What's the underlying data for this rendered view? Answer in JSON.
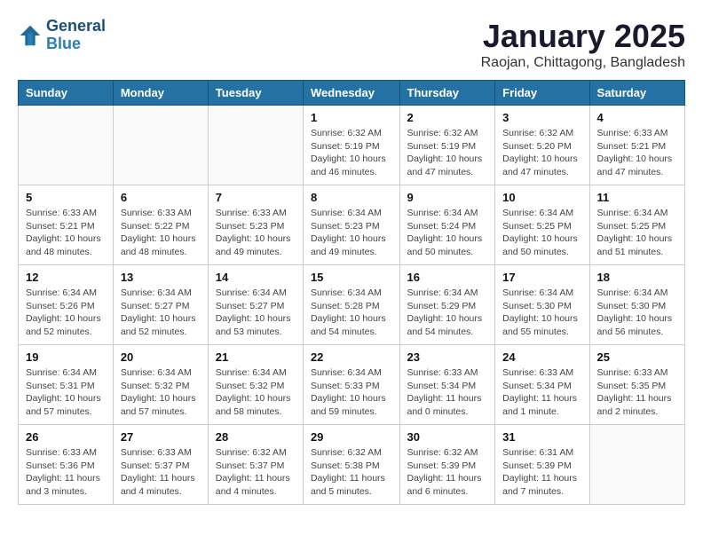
{
  "header": {
    "logo_line1": "General",
    "logo_line2": "Blue",
    "month": "January 2025",
    "location": "Raojan, Chittagong, Bangladesh"
  },
  "weekdays": [
    "Sunday",
    "Monday",
    "Tuesday",
    "Wednesday",
    "Thursday",
    "Friday",
    "Saturday"
  ],
  "weeks": [
    [
      {
        "day": "",
        "info": ""
      },
      {
        "day": "",
        "info": ""
      },
      {
        "day": "",
        "info": ""
      },
      {
        "day": "1",
        "info": "Sunrise: 6:32 AM\nSunset: 5:19 PM\nDaylight: 10 hours\nand 46 minutes."
      },
      {
        "day": "2",
        "info": "Sunrise: 6:32 AM\nSunset: 5:19 PM\nDaylight: 10 hours\nand 47 minutes."
      },
      {
        "day": "3",
        "info": "Sunrise: 6:32 AM\nSunset: 5:20 PM\nDaylight: 10 hours\nand 47 minutes."
      },
      {
        "day": "4",
        "info": "Sunrise: 6:33 AM\nSunset: 5:21 PM\nDaylight: 10 hours\nand 47 minutes."
      }
    ],
    [
      {
        "day": "5",
        "info": "Sunrise: 6:33 AM\nSunset: 5:21 PM\nDaylight: 10 hours\nand 48 minutes."
      },
      {
        "day": "6",
        "info": "Sunrise: 6:33 AM\nSunset: 5:22 PM\nDaylight: 10 hours\nand 48 minutes."
      },
      {
        "day": "7",
        "info": "Sunrise: 6:33 AM\nSunset: 5:23 PM\nDaylight: 10 hours\nand 49 minutes."
      },
      {
        "day": "8",
        "info": "Sunrise: 6:34 AM\nSunset: 5:23 PM\nDaylight: 10 hours\nand 49 minutes."
      },
      {
        "day": "9",
        "info": "Sunrise: 6:34 AM\nSunset: 5:24 PM\nDaylight: 10 hours\nand 50 minutes."
      },
      {
        "day": "10",
        "info": "Sunrise: 6:34 AM\nSunset: 5:25 PM\nDaylight: 10 hours\nand 50 minutes."
      },
      {
        "day": "11",
        "info": "Sunrise: 6:34 AM\nSunset: 5:25 PM\nDaylight: 10 hours\nand 51 minutes."
      }
    ],
    [
      {
        "day": "12",
        "info": "Sunrise: 6:34 AM\nSunset: 5:26 PM\nDaylight: 10 hours\nand 52 minutes."
      },
      {
        "day": "13",
        "info": "Sunrise: 6:34 AM\nSunset: 5:27 PM\nDaylight: 10 hours\nand 52 minutes."
      },
      {
        "day": "14",
        "info": "Sunrise: 6:34 AM\nSunset: 5:27 PM\nDaylight: 10 hours\nand 53 minutes."
      },
      {
        "day": "15",
        "info": "Sunrise: 6:34 AM\nSunset: 5:28 PM\nDaylight: 10 hours\nand 54 minutes."
      },
      {
        "day": "16",
        "info": "Sunrise: 6:34 AM\nSunset: 5:29 PM\nDaylight: 10 hours\nand 54 minutes."
      },
      {
        "day": "17",
        "info": "Sunrise: 6:34 AM\nSunset: 5:30 PM\nDaylight: 10 hours\nand 55 minutes."
      },
      {
        "day": "18",
        "info": "Sunrise: 6:34 AM\nSunset: 5:30 PM\nDaylight: 10 hours\nand 56 minutes."
      }
    ],
    [
      {
        "day": "19",
        "info": "Sunrise: 6:34 AM\nSunset: 5:31 PM\nDaylight: 10 hours\nand 57 minutes."
      },
      {
        "day": "20",
        "info": "Sunrise: 6:34 AM\nSunset: 5:32 PM\nDaylight: 10 hours\nand 57 minutes."
      },
      {
        "day": "21",
        "info": "Sunrise: 6:34 AM\nSunset: 5:32 PM\nDaylight: 10 hours\nand 58 minutes."
      },
      {
        "day": "22",
        "info": "Sunrise: 6:34 AM\nSunset: 5:33 PM\nDaylight: 10 hours\nand 59 minutes."
      },
      {
        "day": "23",
        "info": "Sunrise: 6:33 AM\nSunset: 5:34 PM\nDaylight: 11 hours\nand 0 minutes."
      },
      {
        "day": "24",
        "info": "Sunrise: 6:33 AM\nSunset: 5:34 PM\nDaylight: 11 hours\nand 1 minute."
      },
      {
        "day": "25",
        "info": "Sunrise: 6:33 AM\nSunset: 5:35 PM\nDaylight: 11 hours\nand 2 minutes."
      }
    ],
    [
      {
        "day": "26",
        "info": "Sunrise: 6:33 AM\nSunset: 5:36 PM\nDaylight: 11 hours\nand 3 minutes."
      },
      {
        "day": "27",
        "info": "Sunrise: 6:33 AM\nSunset: 5:37 PM\nDaylight: 11 hours\nand 4 minutes."
      },
      {
        "day": "28",
        "info": "Sunrise: 6:32 AM\nSunset: 5:37 PM\nDaylight: 11 hours\nand 4 minutes."
      },
      {
        "day": "29",
        "info": "Sunrise: 6:32 AM\nSunset: 5:38 PM\nDaylight: 11 hours\nand 5 minutes."
      },
      {
        "day": "30",
        "info": "Sunrise: 6:32 AM\nSunset: 5:39 PM\nDaylight: 11 hours\nand 6 minutes."
      },
      {
        "day": "31",
        "info": "Sunrise: 6:31 AM\nSunset: 5:39 PM\nDaylight: 11 hours\nand 7 minutes."
      },
      {
        "day": "",
        "info": ""
      }
    ]
  ]
}
